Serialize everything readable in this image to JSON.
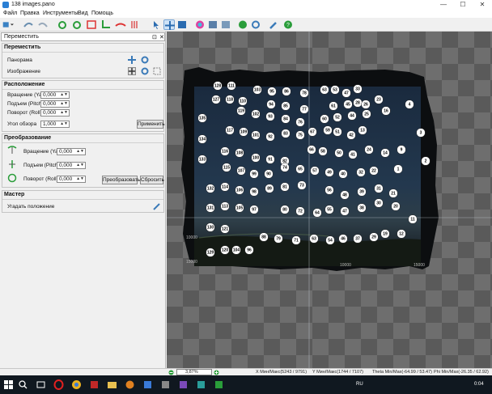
{
  "window": {
    "title": "138 images.pano",
    "minimize_symbol": "—",
    "maximize_symbol": "☐",
    "close_symbol": "✕"
  },
  "menu": [
    "Файл",
    "Правка",
    "Инструменты",
    "Вид",
    "Помощь"
  ],
  "toolbar_icons": [
    "new-project-icon",
    "open-icon",
    "redo-icon",
    "rotate-left-icon",
    "rotate-right-icon",
    "fit-icon",
    "crop-icon",
    "straighten-icon",
    "horizon-icon",
    "pointer-icon",
    "move-icon",
    "pan-icon",
    "color-wheel-icon",
    "adjust-icon",
    "render-icon",
    "settings-icon",
    "wrench-icon",
    "help-icon"
  ],
  "panel": {
    "title": "Переместить",
    "pin_symbol": "⊡",
    "close_symbol": "✕",
    "move_section": {
      "title": "Переместить",
      "panorama_label": "Панорама",
      "image_label": "Изображение"
    },
    "position_section": {
      "title": "Расположение",
      "yaw_label": "Вращение (Yaw)",
      "yaw_value": "0,000",
      "pitch_label": "Подъем (Pitch)",
      "pitch_value": "0,000",
      "roll_label": "Поворот (Roll)",
      "roll_value": "0,000",
      "fov_label": "Угол обзора",
      "fov_value": "1,000",
      "apply_button": "Применить"
    },
    "transform_section": {
      "title": "Преобразование",
      "yaw_label": "Вращение (Yaw)",
      "yaw_value": "0,000",
      "pitch_label": "Подъем (Pitch)",
      "pitch_value": "0,000",
      "roll_label": "Поворот (Roll)",
      "roll_value": "0,000",
      "transform_button": "Преобразовать",
      "reset_button": "Сбросить"
    },
    "wizard_section": {
      "title": "Мастер",
      "guess_label": "Угадать положение"
    }
  },
  "canvas": {
    "axis_labels": [
      "10000",
      "15000",
      "10000",
      "15000"
    ],
    "point_numbers": [
      "128",
      "111",
      "103",
      "95",
      "86",
      "78",
      "63",
      "53",
      "47",
      "33",
      "127",
      "118",
      "110",
      "94",
      "85",
      "77",
      "61",
      "45",
      "28",
      "26",
      "23",
      "4",
      "119",
      "102",
      "93",
      "84",
      "76",
      "60",
      "52",
      "44",
      "25",
      "16",
      "3",
      "135",
      "117",
      "109",
      "101",
      "92",
      "83",
      "75",
      "67",
      "59",
      "51",
      "42",
      "13",
      "134",
      "116",
      "108",
      "100",
      "91",
      "82",
      "66",
      "58",
      "50",
      "41",
      "24",
      "14",
      "9",
      "2",
      "133",
      "115",
      "107",
      "99",
      "90",
      "74",
      "65",
      "57",
      "49",
      "40",
      "32",
      "22",
      "1",
      "132",
      "114",
      "106",
      "98",
      "89",
      "81",
      "73",
      "56",
      "48",
      "39",
      "31",
      "21",
      "131",
      "113",
      "105",
      "97",
      "80",
      "72",
      "64",
      "55",
      "47",
      "38",
      "30",
      "20",
      "130",
      "121",
      "129",
      "120",
      "104",
      "96",
      "88",
      "79",
      "71",
      "63",
      "54",
      "46",
      "37",
      "29",
      "19",
      "12",
      "11"
    ],
    "guide_color": "#c8d0d8"
  },
  "status": {
    "zoom": "3,87%",
    "x_minmax": "X Мин/Макс(5243 / 9791)",
    "y_minmax": "Y Мин/Макс(1744 / 7107)",
    "theta": "Theta Min/Max(-64.99 / 53.47)",
    "phi": "Phi Min/Max(-26.35 / 62.92)"
  },
  "taskbar": {
    "lang": "RU",
    "time": "0:04"
  }
}
